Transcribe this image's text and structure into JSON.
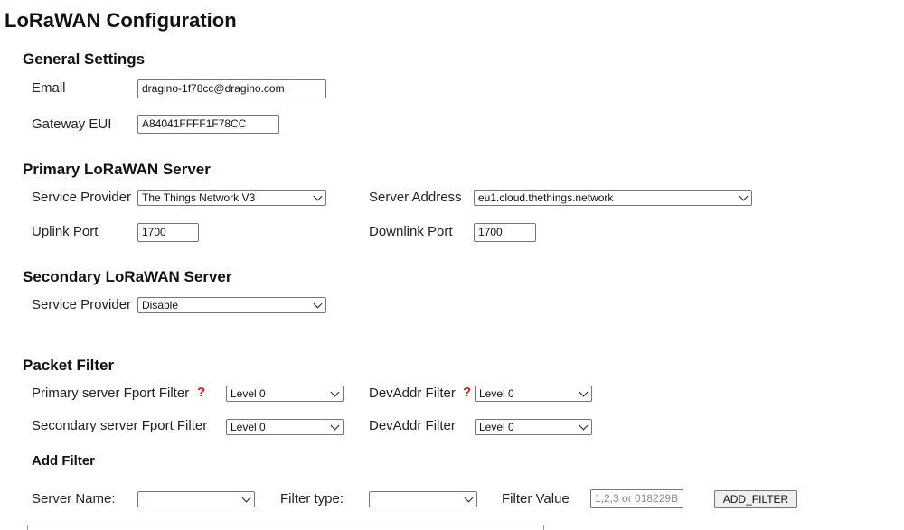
{
  "page": {
    "title": "LoRaWAN Configuration"
  },
  "general": {
    "title": "General Settings",
    "email_label": "Email",
    "email_value": "dragino-1f78cc@dragino.com",
    "gateway_eui_label": "Gateway EUI",
    "gateway_eui_value": "A84041FFFF1F78CC"
  },
  "primary": {
    "title": "Primary LoRaWAN Server",
    "service_provider_label": "Service Provider",
    "service_provider_value": "The Things Network V3",
    "server_address_label": "Server Address",
    "server_address_value": "eu1.cloud.thethings.network",
    "uplink_port_label": "Uplink Port",
    "uplink_port_value": "1700",
    "downlink_port_label": "Downlink Port",
    "downlink_port_value": "1700"
  },
  "secondary": {
    "title": "Secondary LoRaWAN Server",
    "service_provider_label": "Service Provider",
    "service_provider_value": "Disable"
  },
  "filter": {
    "title": "Packet Filter",
    "help_glyph": "?",
    "primary_fport_label": "Primary server Fport Filter",
    "primary_fport_value": "Level 0",
    "primary_devaddr_label": "DevAddr Filter",
    "primary_devaddr_value": "Level 0",
    "secondary_fport_label": "Secondary server Fport Filter",
    "secondary_fport_value": "Level 0",
    "secondary_devaddr_label": "DevAddr Filter",
    "secondary_devaddr_value": "Level 0",
    "add_filter_title": "Add Filter",
    "server_name_label": "Server Name:",
    "server_name_value": "",
    "filter_type_label": "Filter type:",
    "filter_type_value": "",
    "filter_value_label": "Filter Value",
    "filter_value_placeholder": "1,2,3 or 018229B",
    "add_filter_button": "ADD_FILTER"
  },
  "icons": {
    "help": "help-question-icon",
    "dropdown": "chevron-down-icon"
  },
  "colors": {
    "help_accent": "#d12020"
  }
}
